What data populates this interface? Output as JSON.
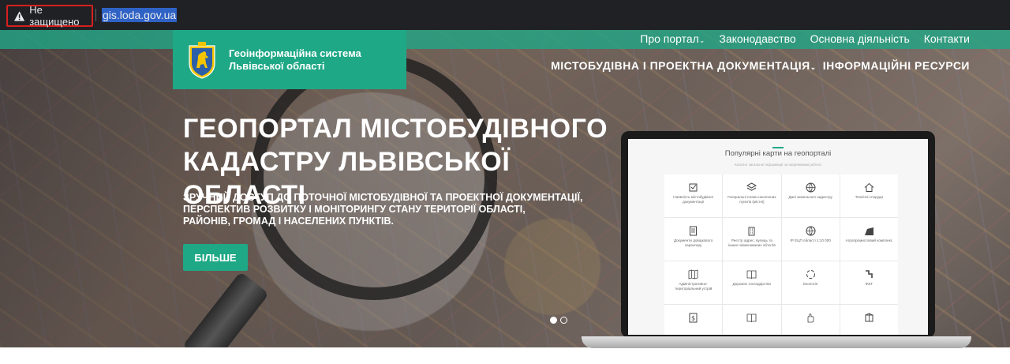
{
  "browser": {
    "security_label": "Не защищено",
    "url": "gis.loda.gov.ua"
  },
  "brand": {
    "title_line1": "Геоінформаційна система",
    "title_line2": "Львівської області"
  },
  "topnav": {
    "items": [
      {
        "label": "Про портал",
        "dropdown": true
      },
      {
        "label": "Законодавство"
      },
      {
        "label": "Основна діяльність"
      },
      {
        "label": "Контакти"
      }
    ]
  },
  "mainnav": {
    "items": [
      {
        "label": "МІСТОБУДІВНА І ПРОЕКТНА ДОКУМЕНТАЦІЯ",
        "dropdown": true
      },
      {
        "label": "ІНФОРМАЦІЙНІ РЕСУРСИ"
      }
    ]
  },
  "hero": {
    "title_line1": "ГЕОПОРТАЛ МІСТОБУДІВНОГО",
    "title_line2": "КАДАСТРУ ЛЬВІВСЬКОЇ ОБЛАСТІ",
    "subtitle_line1": "ЗРУЧНИЙ ДОСТУП ДО ПОТОЧНОЇ МІСТОБУДІВНОЇ ТА ПРОЕКТНОЇ ДОКУМЕНТАЦІЇ,",
    "subtitle_line2": "ПЕРСПЕКТИВ РОЗВИТКУ І МОНІТОРИНГУ СТАНУ ТЕРИТОРІЇ ОБЛАСТІ,",
    "subtitle_line3": "РАЙОНІВ, ГРОМАД І НАСЕЛЕНИХ ПУНКТІВ.",
    "button_label": "БІЛЬШЕ",
    "carousel_active": 1,
    "carousel_count": 2
  },
  "laptop_screen": {
    "title": "Популярні карти на геопорталі",
    "subtitle": "Каталог загальної інформації за напрямками роботи",
    "tiles": [
      {
        "label": "Наявність містобудівної документації",
        "icon": "checkbox-icon"
      },
      {
        "label": "Генеральні плани населених пунктів (містні)",
        "icon": "layers-icon"
      },
      {
        "label": "Дані земельного кадастру",
        "icon": "globe-icon"
      },
      {
        "label": "Технічні споруди",
        "icon": "house-icon"
      },
      {
        "label": "Документи довідкового характеру",
        "icon": "document-icon"
      },
      {
        "label": "Реєстр адрес, вулиць та інших поіменованих об'єктів",
        "icon": "building-icon"
      },
      {
        "label": "ІР ЕЦП області 1:10 000",
        "icon": "globe-icon"
      },
      {
        "label": "Агропромисловий комплекс",
        "icon": "field-icon"
      },
      {
        "label": "Адміністративно-територіальний устрій",
        "icon": "map-icon"
      },
      {
        "label": "Дорожнє господарство",
        "icon": "book-icon"
      },
      {
        "label": "Екологія",
        "icon": "recycle-icon"
      },
      {
        "label": "ЖКГ",
        "icon": "pipe-icon"
      },
      {
        "label": "",
        "icon": "dollar-icon"
      },
      {
        "label": "",
        "icon": "book-icon"
      },
      {
        "label": "",
        "icon": "hand-icon"
      },
      {
        "label": "",
        "icon": "box-icon"
      }
    ]
  },
  "colors": {
    "accent": "#1fa886",
    "warning_outline": "#d62020",
    "browser_bar": "#202124"
  }
}
